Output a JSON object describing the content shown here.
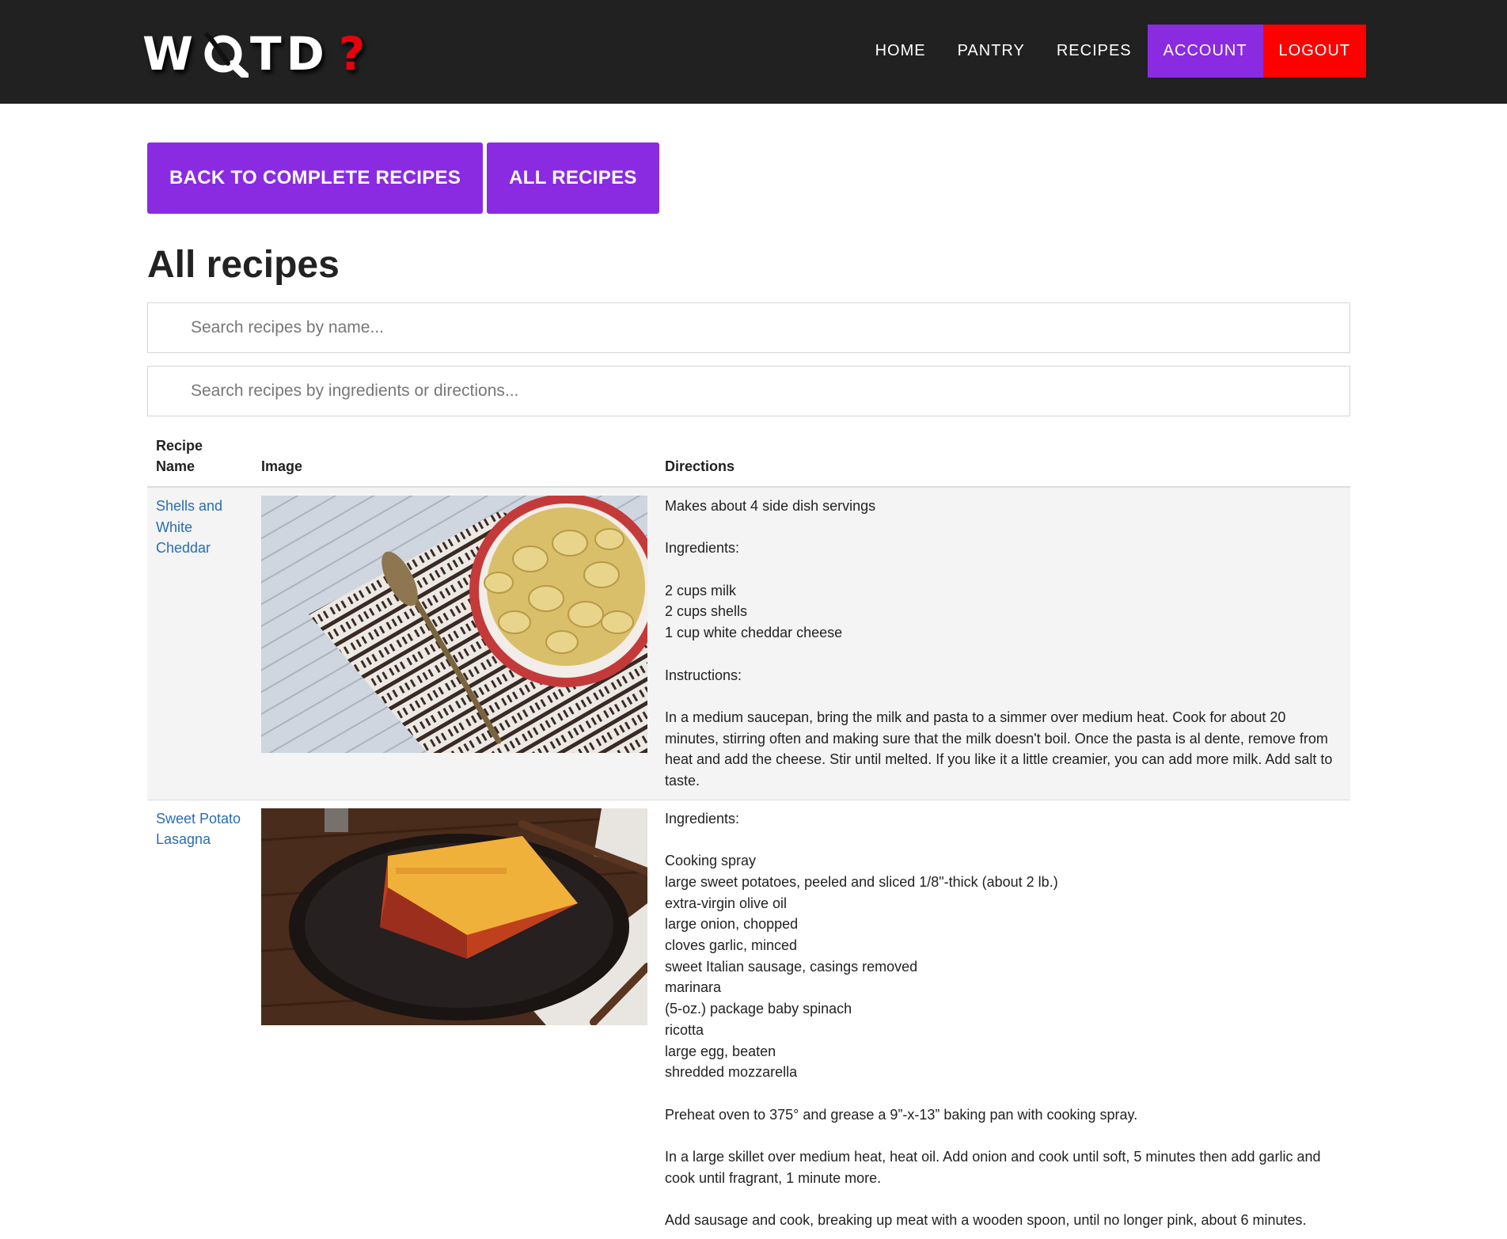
{
  "nav": {
    "logo": {
      "w": "W",
      "t": "T",
      "d": "D",
      "q": "?"
    },
    "items": [
      "HOME",
      "PANTRY",
      "RECIPES",
      "ACCOUNT",
      "LOGOUT"
    ]
  },
  "buttons": {
    "back": "BACK TO COMPLETE RECIPES",
    "all": "ALL RECIPES"
  },
  "page_title": "All recipes",
  "search": {
    "name_placeholder": "Search recipes by name...",
    "ingredients_placeholder": "Search recipes by ingredients or directions..."
  },
  "table": {
    "headers": {
      "name_line1": "Recipe",
      "name_line2": "Name",
      "image": "Image",
      "directions": "Directions"
    },
    "rows": [
      {
        "name": "Shells and White Cheddar",
        "directions": [
          "Makes about 4 side dish servings",
          "",
          "Ingredients:",
          "",
          "2 cups milk",
          "2 cups shells",
          "1 cup white cheddar cheese",
          "",
          "Instructions:",
          "",
          "In a medium saucepan, bring the milk and pasta to a simmer over medium heat. Cook for about 20 minutes, stirring often and making sure that the milk doesn't boil. Once the pasta is al dente, remove from heat and add the cheese. Stir until melted. If you like it a little creamier, you can add more milk. Add salt to taste."
        ]
      },
      {
        "name": "Sweet Potato Lasagna",
        "directions": [
          "Ingredients:",
          "",
          "Cooking spray",
          "large sweet potatoes, peeled and sliced 1/8\"-thick (about 2 lb.)",
          "extra-virgin olive oil",
          "large onion, chopped",
          "cloves garlic, minced",
          "sweet Italian sausage, casings removed",
          "marinara",
          "(5-oz.) package baby spinach",
          "ricotta",
          "large egg, beaten",
          "shredded mozzarella",
          "",
          "Preheat oven to 375° and grease a 9”-x-13” baking pan with cooking spray.",
          "",
          "In a large skillet over medium heat, heat oil. Add onion and cook until soft, 5 minutes then add garlic and cook until fragrant, 1 minute more.",
          "",
          "Add sausage and cook, breaking up meat with a wooden spoon, until no longer pink, about 6 minutes."
        ]
      }
    ]
  }
}
